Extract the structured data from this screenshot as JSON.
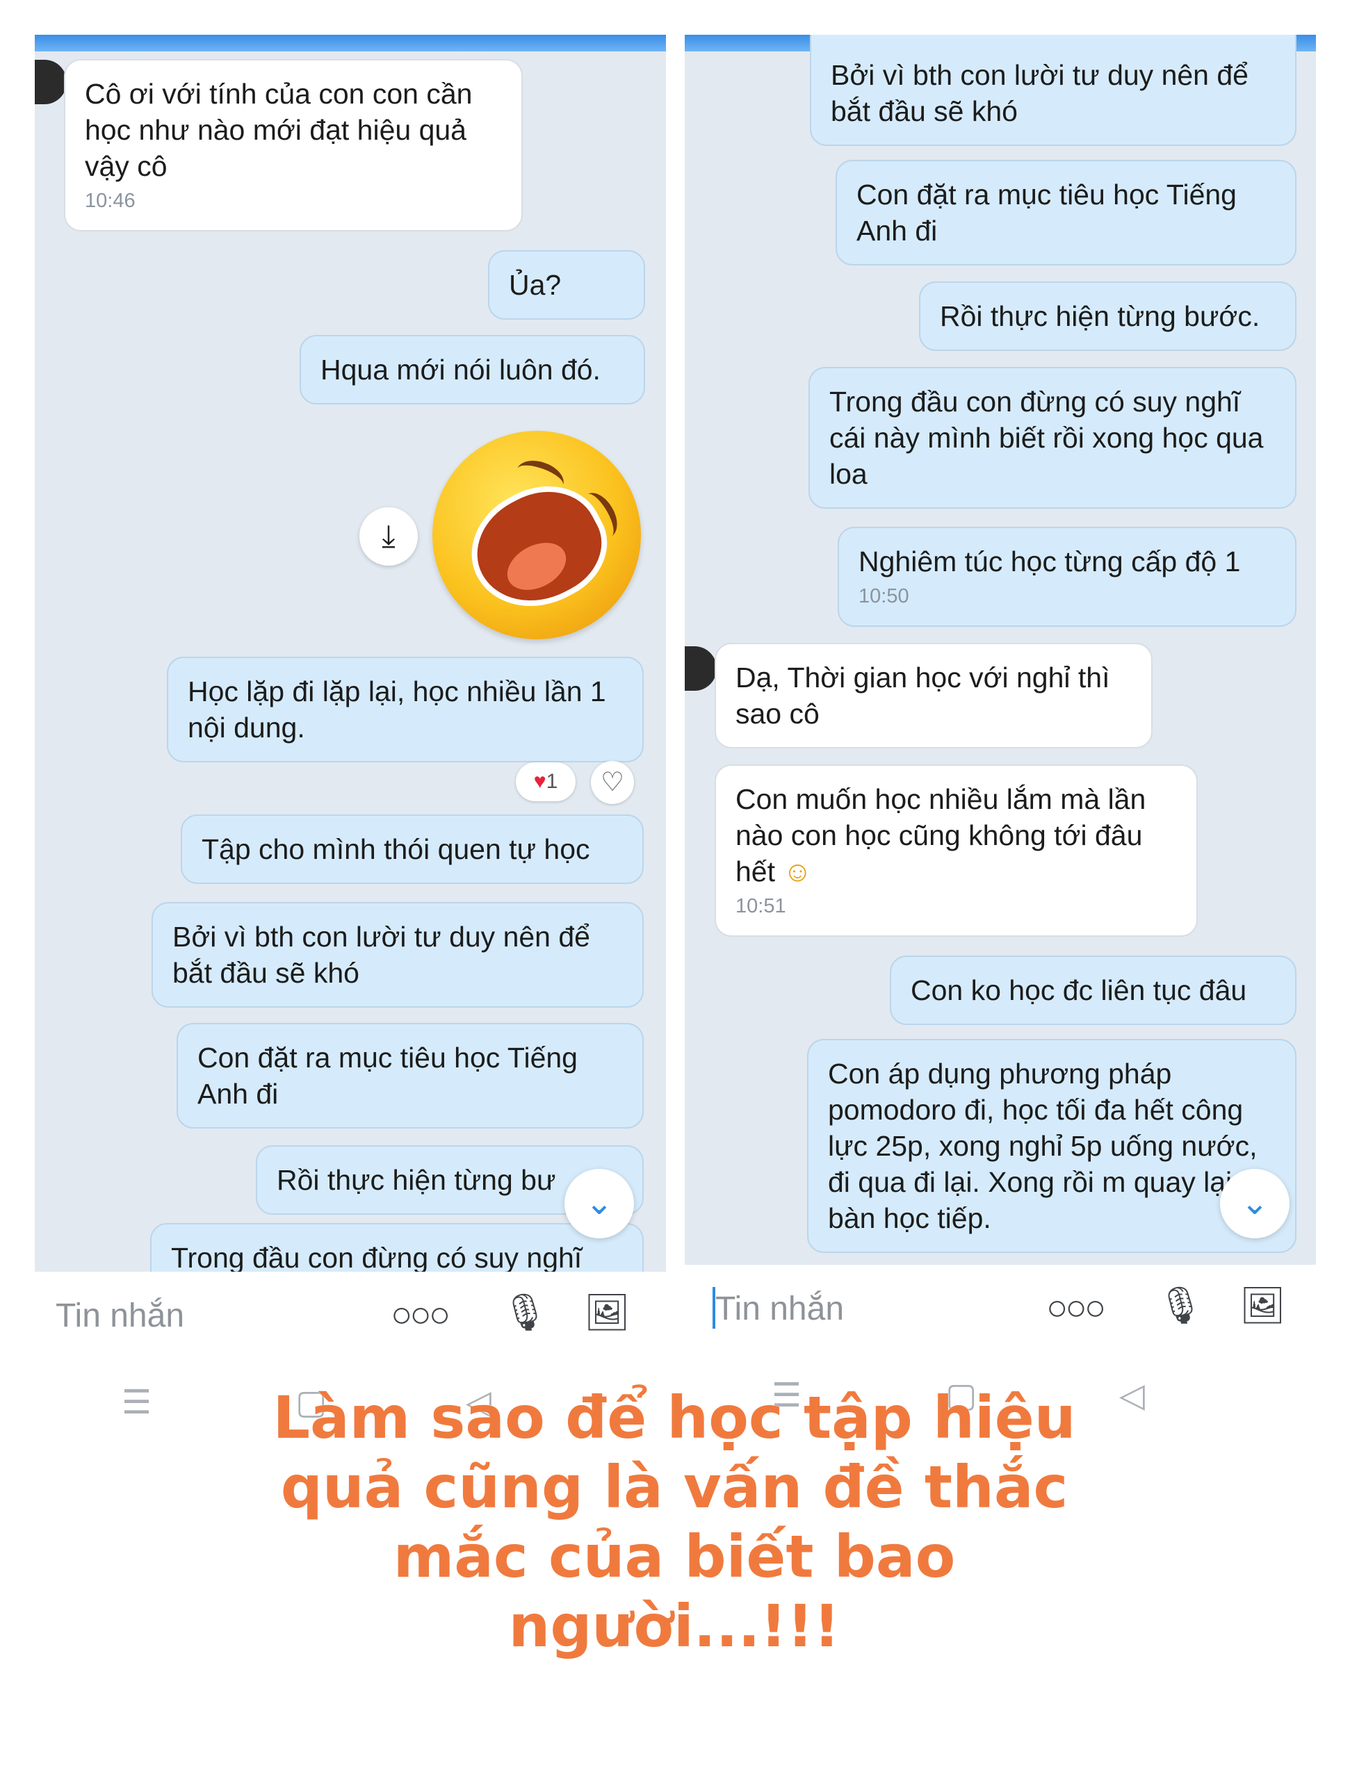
{
  "left_chat": {
    "messages": [
      {
        "text": "Cô ơi với tính của con con cần học như nào mới đạt hiệu quả vậy cô",
        "time": "10:46"
      },
      {
        "text": "Ủa?"
      },
      {
        "text": "Hqua mới nói luôn đó."
      },
      {
        "text": "Học lặp đi lặp lại, học nhiều lần 1 nội dung."
      },
      {
        "text": "Tập cho mình thói quen tự học"
      },
      {
        "text": "Bởi vì bth con lười tư duy nên để bắt đầu sẽ khó"
      },
      {
        "text": "Con đặt ra mục tiêu học Tiếng Anh đi"
      },
      {
        "text": "Rồi thực hiện từng bư"
      },
      {
        "text": "Trong đầu con đừng có suy nghĩ"
      }
    ],
    "reaction_count": "1",
    "reaction_icon": "heart-icon",
    "input_placeholder": "Tin nhắn",
    "input_icons": [
      "more-icon",
      "microphone-icon",
      "image-icon"
    ]
  },
  "right_chat": {
    "messages": [
      {
        "text": "Bởi vì bth con lười tư duy nên để bắt đầu sẽ khó"
      },
      {
        "text": "Con đặt ra mục tiêu học Tiếng Anh đi"
      },
      {
        "text": "Rồi thực hiện từng bước."
      },
      {
        "text": "Trong đầu con đừng có suy nghĩ cái này mình biết rồi xong học qua loa"
      },
      {
        "text": "Nghiêm túc học từng cấp độ 1",
        "time": "10:50"
      },
      {
        "text": "Dạ, Thời gian học với nghỉ thì sao cô"
      },
      {
        "text": "Con muốn học nhiều lắm mà lần nào con học cũng không tới đâu hết",
        "emoji": "☺",
        "time": "10:51"
      },
      {
        "text": "Con ko học đc liên tục đâu"
      },
      {
        "text": "Con áp dụng phương pháp pomodoro đi, học tối đa hết công lực 25p, xong nghỉ 5p uống nước, đi qua đi lại. Xong rồi m quay lại bàn học tiếp."
      }
    ],
    "input_placeholder": "Tin nhắn"
  },
  "caption": "Làm sao để học tập hiệu quả cũng là vấn đề thắc mắc của biết bao người...!!!",
  "colors": {
    "accent": "#2d8be4",
    "caption": "#f07a3e",
    "my_bubble": "#d5ebfb",
    "chat_bg": "#e2e9f1"
  }
}
